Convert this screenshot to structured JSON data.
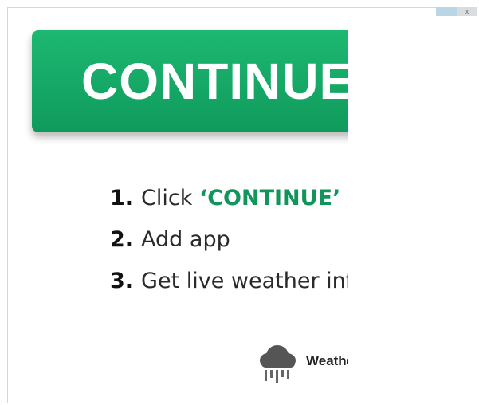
{
  "cta": {
    "label": "CONTINUE"
  },
  "steps": [
    {
      "num": "1.",
      "text": "Click ",
      "highlight": "‘CONTINUE’"
    },
    {
      "num": "2.",
      "text": "Add app"
    },
    {
      "num": "3.",
      "text": "Get live weather info"
    }
  ],
  "brand": {
    "name": "Weather",
    "icon": "cloud-rain-icon"
  },
  "adchoices": {
    "icon": "adchoices-icon",
    "close_glyph": "x"
  },
  "colors": {
    "cta_green": "#12a865",
    "highlight_green": "#12955a",
    "text": "#2a2a2a"
  }
}
